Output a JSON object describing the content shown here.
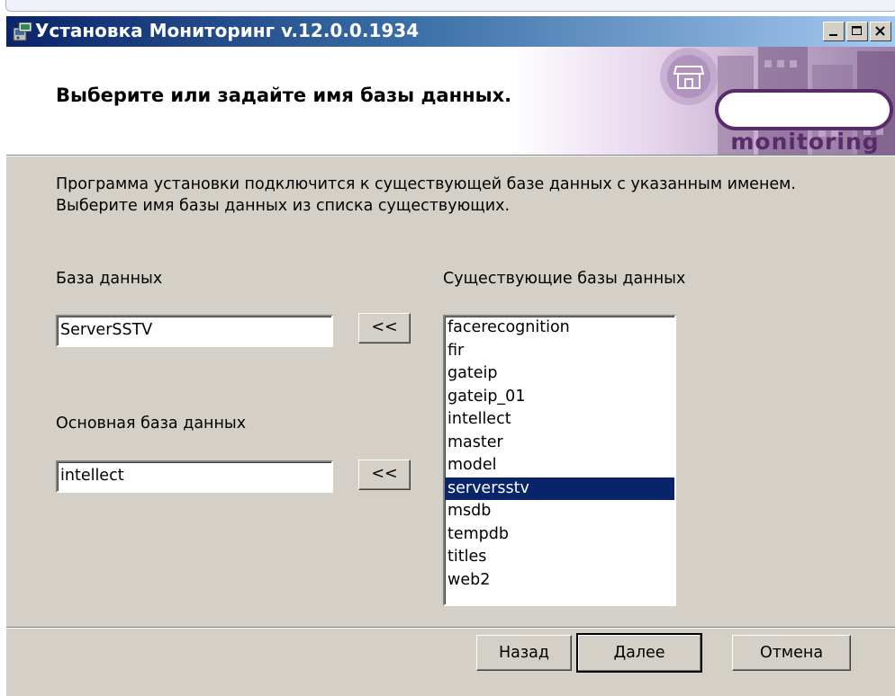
{
  "window": {
    "title": "Установка Мониторинг v.12.0.0.1934"
  },
  "header": {
    "title": "Выберите или задайте имя базы данных.",
    "brand": "monitoring"
  },
  "description": {
    "line1": "Программа установки подключится к существующей базе данных с указанным именем.",
    "line2": "Выберите имя базы данных из списка существующих."
  },
  "database": {
    "label": "База данных",
    "value": "ServerSSTV",
    "copy_button": "<<"
  },
  "main_database": {
    "label": "Основная база данных",
    "value": "intellect",
    "copy_button": "<<"
  },
  "existing": {
    "label": "Существующие базы данных",
    "items": [
      "facerecognition",
      "fir",
      "gateip",
      "gateip_01",
      "intellect",
      "master",
      "model",
      "serversstv",
      "msdb",
      "tempdb",
      "titles",
      "web2"
    ],
    "selected": "serversstv"
  },
  "buttons": {
    "back": "Назад",
    "next": "Далее",
    "cancel": "Отмена"
  },
  "colors": {
    "selection": "#0a246a",
    "dialog_bg": "#d4d0c8",
    "brand_ring": "#5a2a6a"
  }
}
